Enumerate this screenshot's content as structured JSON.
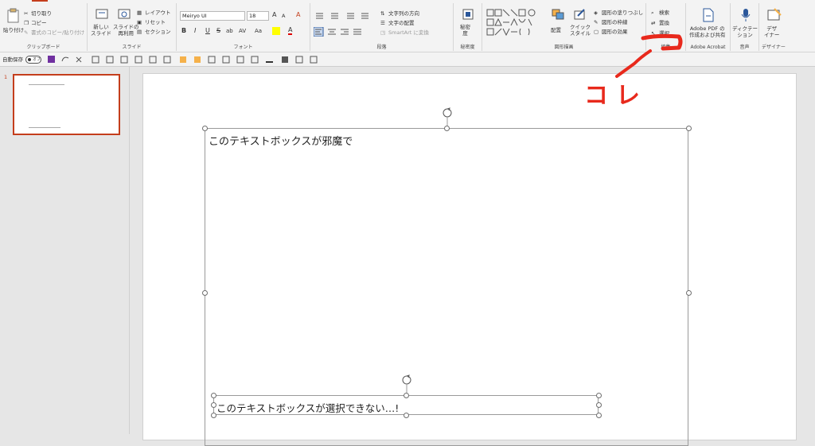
{
  "ribbon": {
    "clipboard": {
      "paste_label": "貼り付け",
      "cut_label": "切り取り",
      "copy_label": "コピー",
      "format_painter_label": "書式のコピー/貼り付け",
      "group_label": "クリップボード"
    },
    "slides": {
      "new_slide_label": "新しい\nスライド",
      "reuse_label": "スライドの\n再利用",
      "layout_label": "レイアウト",
      "reset_label": "リセット",
      "section_label": "セクション",
      "group_label": "スライド"
    },
    "font": {
      "font_name": "Meiryo UI",
      "font_size": "18",
      "group_label": "フォント",
      "bold": "B",
      "italic": "I",
      "underline": "U",
      "strike": "S",
      "shadow": "ab",
      "spacing": "AV",
      "case": "Aa",
      "grow": "A",
      "shrink": "A",
      "clear": "A"
    },
    "paragraph": {
      "text_direction_label": "文字列の方向",
      "align_text_label": "文字の配置",
      "smartart_label": "SmartArt に変換",
      "group_label": "段落"
    },
    "secret": {
      "label": "秘密\n度",
      "group_label": "秘密度"
    },
    "drawing": {
      "arrange_label": "配置",
      "quick_styles_label": "クイック\nスタイル",
      "fill_label": "図形の塗りつぶし",
      "outline_label": "図形の枠線",
      "effects_label": "図形の効果",
      "group_label": "図形描画"
    },
    "editing": {
      "find_label": "検索",
      "replace_label": "置換",
      "select_label": "選択",
      "group_label": "編集"
    },
    "acrobat": {
      "label": "Adobe PDF の\n作成および共有",
      "group_label": "Adobe Acrobat"
    },
    "voice": {
      "label": "ディクテー\nション",
      "group_label": "音声"
    },
    "designer": {
      "label": "デザ\nイナー",
      "group_label": "デザイナー"
    }
  },
  "qat": {
    "autosave_label": "自動保存",
    "autosave_state": "オフ"
  },
  "thumbnails": {
    "slide_number": "1"
  },
  "slide": {
    "textbox1_text": "このテキストボックスが邪魔で",
    "textbox2_text": "このテキストボックスが選択できない…!"
  },
  "annotation": {
    "text": "コレ",
    "color": "#e8291c"
  },
  "colors": {
    "accent": "#c43e1c",
    "ribbon_bg": "#f3f3f3",
    "canvas_bg": "#e6e6e6"
  }
}
